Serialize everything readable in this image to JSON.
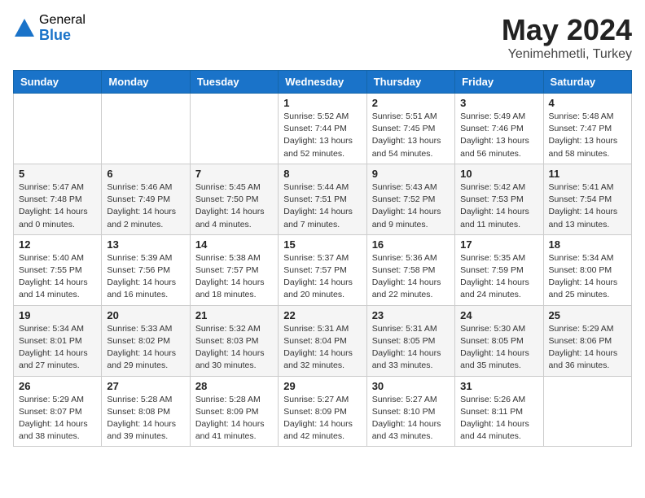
{
  "header": {
    "logo_general": "General",
    "logo_blue": "Blue",
    "title": "May 2024",
    "location": "Yenimehmetli, Turkey"
  },
  "weekdays": [
    "Sunday",
    "Monday",
    "Tuesday",
    "Wednesday",
    "Thursday",
    "Friday",
    "Saturday"
  ],
  "weeks": [
    [
      {
        "day": "",
        "info": ""
      },
      {
        "day": "",
        "info": ""
      },
      {
        "day": "",
        "info": ""
      },
      {
        "day": "1",
        "info": "Sunrise: 5:52 AM\nSunset: 7:44 PM\nDaylight: 13 hours\nand 52 minutes."
      },
      {
        "day": "2",
        "info": "Sunrise: 5:51 AM\nSunset: 7:45 PM\nDaylight: 13 hours\nand 54 minutes."
      },
      {
        "day": "3",
        "info": "Sunrise: 5:49 AM\nSunset: 7:46 PM\nDaylight: 13 hours\nand 56 minutes."
      },
      {
        "day": "4",
        "info": "Sunrise: 5:48 AM\nSunset: 7:47 PM\nDaylight: 13 hours\nand 58 minutes."
      }
    ],
    [
      {
        "day": "5",
        "info": "Sunrise: 5:47 AM\nSunset: 7:48 PM\nDaylight: 14 hours\nand 0 minutes."
      },
      {
        "day": "6",
        "info": "Sunrise: 5:46 AM\nSunset: 7:49 PM\nDaylight: 14 hours\nand 2 minutes."
      },
      {
        "day": "7",
        "info": "Sunrise: 5:45 AM\nSunset: 7:50 PM\nDaylight: 14 hours\nand 4 minutes."
      },
      {
        "day": "8",
        "info": "Sunrise: 5:44 AM\nSunset: 7:51 PM\nDaylight: 14 hours\nand 7 minutes."
      },
      {
        "day": "9",
        "info": "Sunrise: 5:43 AM\nSunset: 7:52 PM\nDaylight: 14 hours\nand 9 minutes."
      },
      {
        "day": "10",
        "info": "Sunrise: 5:42 AM\nSunset: 7:53 PM\nDaylight: 14 hours\nand 11 minutes."
      },
      {
        "day": "11",
        "info": "Sunrise: 5:41 AM\nSunset: 7:54 PM\nDaylight: 14 hours\nand 13 minutes."
      }
    ],
    [
      {
        "day": "12",
        "info": "Sunrise: 5:40 AM\nSunset: 7:55 PM\nDaylight: 14 hours\nand 14 minutes."
      },
      {
        "day": "13",
        "info": "Sunrise: 5:39 AM\nSunset: 7:56 PM\nDaylight: 14 hours\nand 16 minutes."
      },
      {
        "day": "14",
        "info": "Sunrise: 5:38 AM\nSunset: 7:57 PM\nDaylight: 14 hours\nand 18 minutes."
      },
      {
        "day": "15",
        "info": "Sunrise: 5:37 AM\nSunset: 7:57 PM\nDaylight: 14 hours\nand 20 minutes."
      },
      {
        "day": "16",
        "info": "Sunrise: 5:36 AM\nSunset: 7:58 PM\nDaylight: 14 hours\nand 22 minutes."
      },
      {
        "day": "17",
        "info": "Sunrise: 5:35 AM\nSunset: 7:59 PM\nDaylight: 14 hours\nand 24 minutes."
      },
      {
        "day": "18",
        "info": "Sunrise: 5:34 AM\nSunset: 8:00 PM\nDaylight: 14 hours\nand 25 minutes."
      }
    ],
    [
      {
        "day": "19",
        "info": "Sunrise: 5:34 AM\nSunset: 8:01 PM\nDaylight: 14 hours\nand 27 minutes."
      },
      {
        "day": "20",
        "info": "Sunrise: 5:33 AM\nSunset: 8:02 PM\nDaylight: 14 hours\nand 29 minutes."
      },
      {
        "day": "21",
        "info": "Sunrise: 5:32 AM\nSunset: 8:03 PM\nDaylight: 14 hours\nand 30 minutes."
      },
      {
        "day": "22",
        "info": "Sunrise: 5:31 AM\nSunset: 8:04 PM\nDaylight: 14 hours\nand 32 minutes."
      },
      {
        "day": "23",
        "info": "Sunrise: 5:31 AM\nSunset: 8:05 PM\nDaylight: 14 hours\nand 33 minutes."
      },
      {
        "day": "24",
        "info": "Sunrise: 5:30 AM\nSunset: 8:05 PM\nDaylight: 14 hours\nand 35 minutes."
      },
      {
        "day": "25",
        "info": "Sunrise: 5:29 AM\nSunset: 8:06 PM\nDaylight: 14 hours\nand 36 minutes."
      }
    ],
    [
      {
        "day": "26",
        "info": "Sunrise: 5:29 AM\nSunset: 8:07 PM\nDaylight: 14 hours\nand 38 minutes."
      },
      {
        "day": "27",
        "info": "Sunrise: 5:28 AM\nSunset: 8:08 PM\nDaylight: 14 hours\nand 39 minutes."
      },
      {
        "day": "28",
        "info": "Sunrise: 5:28 AM\nSunset: 8:09 PM\nDaylight: 14 hours\nand 41 minutes."
      },
      {
        "day": "29",
        "info": "Sunrise: 5:27 AM\nSunset: 8:09 PM\nDaylight: 14 hours\nand 42 minutes."
      },
      {
        "day": "30",
        "info": "Sunrise: 5:27 AM\nSunset: 8:10 PM\nDaylight: 14 hours\nand 43 minutes."
      },
      {
        "day": "31",
        "info": "Sunrise: 5:26 AM\nSunset: 8:11 PM\nDaylight: 14 hours\nand 44 minutes."
      },
      {
        "day": "",
        "info": ""
      }
    ]
  ]
}
